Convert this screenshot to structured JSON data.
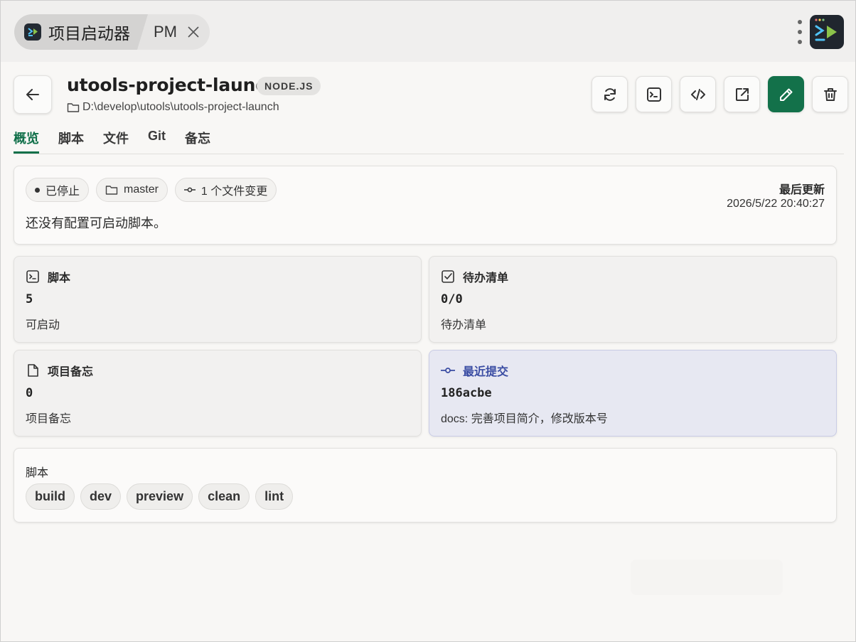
{
  "titlebar": {
    "app_tab_title": "项目启动器",
    "second_tab_label": "PM"
  },
  "project": {
    "name": "utools-project-launch",
    "badge": "NODE.JS",
    "path": "D:\\develop\\utools\\utools-project-launch"
  },
  "actions": [
    "refresh-icon",
    "terminal-icon",
    "code-icon",
    "external-link-icon",
    "edit-icon",
    "trash-icon"
  ],
  "nav": {
    "tabs": [
      "概览",
      "脚本",
      "文件",
      "Git",
      "备忘"
    ],
    "active_index": 0
  },
  "status": {
    "state_label": "已停止",
    "branch_label": "master",
    "changes_label": "1 个文件变更",
    "message": "还没有配置可启动脚本。",
    "last_updated_label": "最后更新",
    "last_updated_time": "2026/5/22 20:40:27"
  },
  "stats": {
    "scripts": {
      "title": "脚本",
      "value": "5",
      "sub": "可启动"
    },
    "todos": {
      "title": "待办清单",
      "value": "0/0",
      "sub": "待办清单"
    },
    "memos": {
      "title": "项目备忘",
      "value": "0",
      "sub": "项目备忘"
    },
    "commit": {
      "title": "最近提交",
      "value": "186acbe",
      "sub": "docs: 完善项目简介，修改版本号"
    }
  },
  "scripts": {
    "title": "脚本",
    "items": [
      "build",
      "dev",
      "preview",
      "clean",
      "lint"
    ]
  },
  "colors": {
    "accent": "#13714a",
    "commit_accent": "#3a4ca3",
    "commit_bg": "#e7e8f2"
  }
}
